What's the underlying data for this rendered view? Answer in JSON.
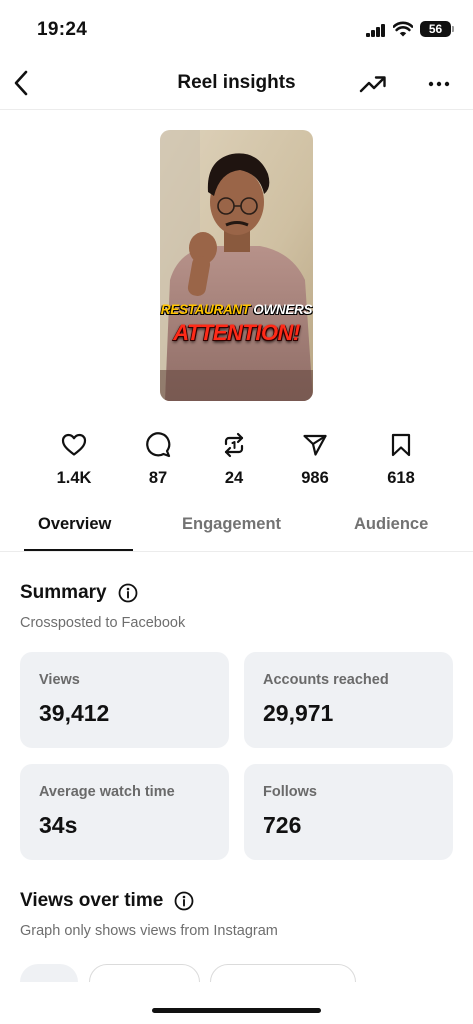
{
  "status_bar": {
    "time": "19:24",
    "battery": "56"
  },
  "header": {
    "title": "Reel insights",
    "back_icon": "chevron-left-icon",
    "trend_icon": "trending-up-icon",
    "more_icon": "more-horizontal-icon"
  },
  "reel": {
    "overlay_word_1": "RESTAURANT",
    "overlay_word_2": "OWNERS",
    "overlay_word_3": "ATTENTION!",
    "accent_yellow": "#ffc400",
    "accent_red": "#ff2a18"
  },
  "stats": [
    {
      "icon": "heart-icon",
      "value": "1.4K"
    },
    {
      "icon": "comment-icon",
      "value": "87"
    },
    {
      "icon": "repost-icon",
      "value": "24"
    },
    {
      "icon": "share-icon",
      "value": "986"
    },
    {
      "icon": "bookmark-icon",
      "value": "618"
    }
  ],
  "tabs": [
    {
      "label": "Overview",
      "active": true
    },
    {
      "label": "Engagement",
      "active": false
    },
    {
      "label": "Audience",
      "active": false
    }
  ],
  "summary": {
    "title": "Summary",
    "subtitle": "Crossposted to Facebook",
    "metrics": [
      {
        "label": "Views",
        "value": "39,412"
      },
      {
        "label": "Accounts reached",
        "value": "29,971"
      },
      {
        "label": "Average watch time",
        "value": "34s"
      },
      {
        "label": "Follows",
        "value": "726"
      }
    ]
  },
  "views_over_time": {
    "title": "Views over time",
    "subtitle": "Graph only shows views from Instagram"
  },
  "colors": {
    "card_bg": "#eff1f4",
    "text_primary": "#111111",
    "text_secondary": "#6e6e6e"
  }
}
